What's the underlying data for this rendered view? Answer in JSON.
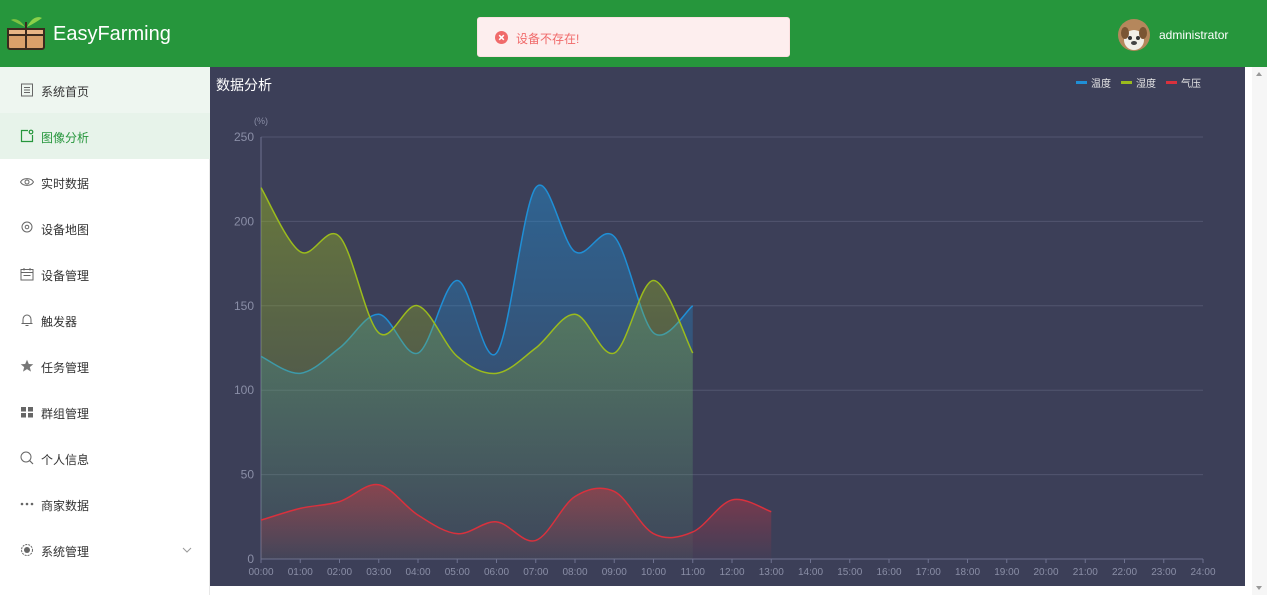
{
  "header": {
    "brand": "EasyFarming",
    "toast_message": "设备不存在!",
    "username": "administrator"
  },
  "icons": {
    "logo": "farm-box-logo",
    "toast": "error-circle-icon",
    "avatar": "user-avatar"
  },
  "sidebar": {
    "items": [
      {
        "label": "系统首页",
        "icon": "document-icon"
      },
      {
        "label": "图像分析",
        "icon": "image-analysis-icon"
      },
      {
        "label": "实时数据",
        "icon": "eye-icon"
      },
      {
        "label": "设备地图",
        "icon": "location-icon"
      },
      {
        "label": "设备管理",
        "icon": "calendar-icon"
      },
      {
        "label": "触发器",
        "icon": "bell-icon"
      },
      {
        "label": "任务管理",
        "icon": "star-icon"
      },
      {
        "label": "群组管理",
        "icon": "grid-icon"
      },
      {
        "label": "个人信息",
        "icon": "search-icon"
      },
      {
        "label": "商家数据",
        "icon": "more-dots-icon"
      },
      {
        "label": "系统管理",
        "icon": "settings-icon"
      }
    ],
    "active_index": 1
  },
  "colors": {
    "header": "#26963c",
    "panel": "#3c3f58",
    "temperature": "#1f8fd6",
    "humidity": "#9bbb1d",
    "pressure": "#d9313d"
  },
  "panel": {
    "title": "数据分析"
  },
  "chart_data": {
    "type": "line",
    "title": "数据分析",
    "ylabel": "(%)",
    "ylim": [
      0,
      250
    ],
    "yticks": [
      0,
      50,
      100,
      150,
      200,
      250
    ],
    "xlabels": [
      "00:00",
      "01:00",
      "02:00",
      "03:00",
      "04:00",
      "05:00",
      "06:00",
      "07:00",
      "08:00",
      "09:00",
      "10:00",
      "11:00",
      "12:00",
      "13:00",
      "14:00",
      "15:00",
      "16:00",
      "17:00",
      "18:00",
      "19:00",
      "20:00",
      "21:00",
      "22:00",
      "23:00",
      "24:00"
    ],
    "grid": true,
    "legend_position": "top-right",
    "series": [
      {
        "name": "温度",
        "color": "#1f8fd6",
        "values": [
          120,
          110,
          125,
          145,
          122,
          165,
          122,
          220,
          182,
          191,
          134,
          150
        ]
      },
      {
        "name": "湿度",
        "color": "#9bbb1d",
        "values": [
          220,
          182,
          191,
          134,
          150,
          120,
          110,
          125,
          145,
          122,
          165,
          122
        ]
      },
      {
        "name": "气压",
        "color": "#d9313d",
        "values": [
          23,
          30,
          34,
          44,
          26,
          15,
          22,
          11,
          37,
          40,
          15,
          16,
          35,
          28
        ]
      }
    ]
  }
}
